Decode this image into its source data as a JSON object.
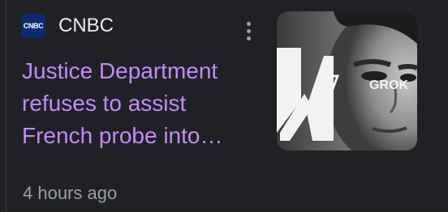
{
  "source": {
    "name": "CNBC",
    "logo_text": "CNBC"
  },
  "article": {
    "headline_lines": [
      "Justice Department",
      "refuses to assist",
      "French probe into…"
    ],
    "time": "4 hours ago"
  },
  "thumbnail": {
    "overlay_text": "GROK"
  },
  "colors": {
    "background": "#202124",
    "headline": "#c58af9",
    "source_text": "#e8eaed",
    "meta_text": "#9aa0a6"
  },
  "icons": {
    "menu": "more-vert-icon"
  }
}
